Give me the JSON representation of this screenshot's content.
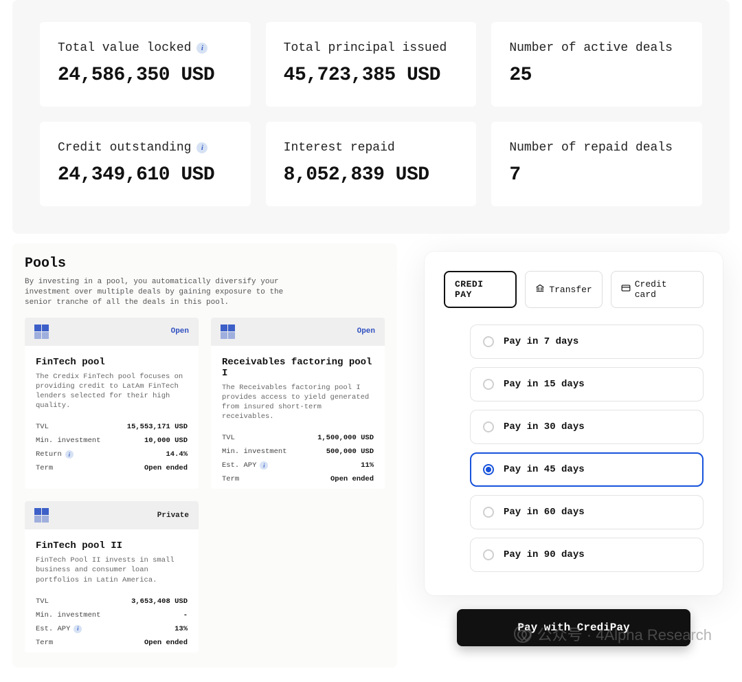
{
  "stats": [
    {
      "label": "Total value locked",
      "value": "24,586,350 USD",
      "info": true
    },
    {
      "label": "Total principal issued",
      "value": "45,723,385 USD",
      "info": false
    },
    {
      "label": "Number of active deals",
      "value": "25",
      "info": false
    },
    {
      "label": "Credit outstanding",
      "value": "24,349,610 USD",
      "info": true
    },
    {
      "label": "Interest repaid",
      "value": "8,052,839 USD",
      "info": false
    },
    {
      "label": "Number of repaid deals",
      "value": "7",
      "info": false
    }
  ],
  "pools": {
    "title": "Pools",
    "description": "By investing in a pool, you automatically diversify your investment over multiple deals by gaining exposure to the senior tranche of all the deals in this pool.",
    "items": [
      {
        "status": "Open",
        "name": "FinTech pool",
        "text": "The Credix FinTech pool focuses on providing credit to LatAm FinTech lenders selected for their high quality.",
        "rows": [
          {
            "label": "TVL",
            "value": "15,553,171 USD",
            "info": false
          },
          {
            "label": "Min. investment",
            "value": "10,000 USD",
            "info": false
          },
          {
            "label": "Return",
            "value": "14.4%",
            "info": true
          },
          {
            "label": "Term",
            "value": "Open ended",
            "info": false
          }
        ]
      },
      {
        "status": "Open",
        "name": "Receivables factoring pool I",
        "text": "The Receivables factoring pool I provides access to yield generated from insured short-term receivables.",
        "rows": [
          {
            "label": "TVL",
            "value": "1,500,000 USD",
            "info": false
          },
          {
            "label": "Min. investment",
            "value": "500,000 USD",
            "info": false
          },
          {
            "label": "Est. APY",
            "value": "11%",
            "info": true
          },
          {
            "label": "Term",
            "value": "Open ended",
            "info": false
          }
        ]
      },
      {
        "status": "Private",
        "name": "FinTech pool II",
        "text": "FinTech Pool II invests in small business and consumer loan portfolios in Latin America.",
        "rows": [
          {
            "label": "TVL",
            "value": "3,653,408 USD",
            "info": false
          },
          {
            "label": "Min. investment",
            "value": "-",
            "info": false
          },
          {
            "label": "Est. APY",
            "value": "13%",
            "info": true
          },
          {
            "label": "Term",
            "value": "Open ended",
            "info": false
          }
        ]
      }
    ]
  },
  "pay": {
    "tabs": {
      "credipay": "CREDI PAY",
      "transfer": "Transfer",
      "card": "Credit card"
    },
    "options": [
      "Pay in 7 days",
      "Pay in 15 days",
      "Pay in 30 days",
      "Pay in 45 days",
      "Pay in 60 days",
      "Pay in 90 days"
    ],
    "selected_index": 3,
    "button": "Pay with CrediPay"
  },
  "watermark": "公众号 · 4Alpha Research"
}
